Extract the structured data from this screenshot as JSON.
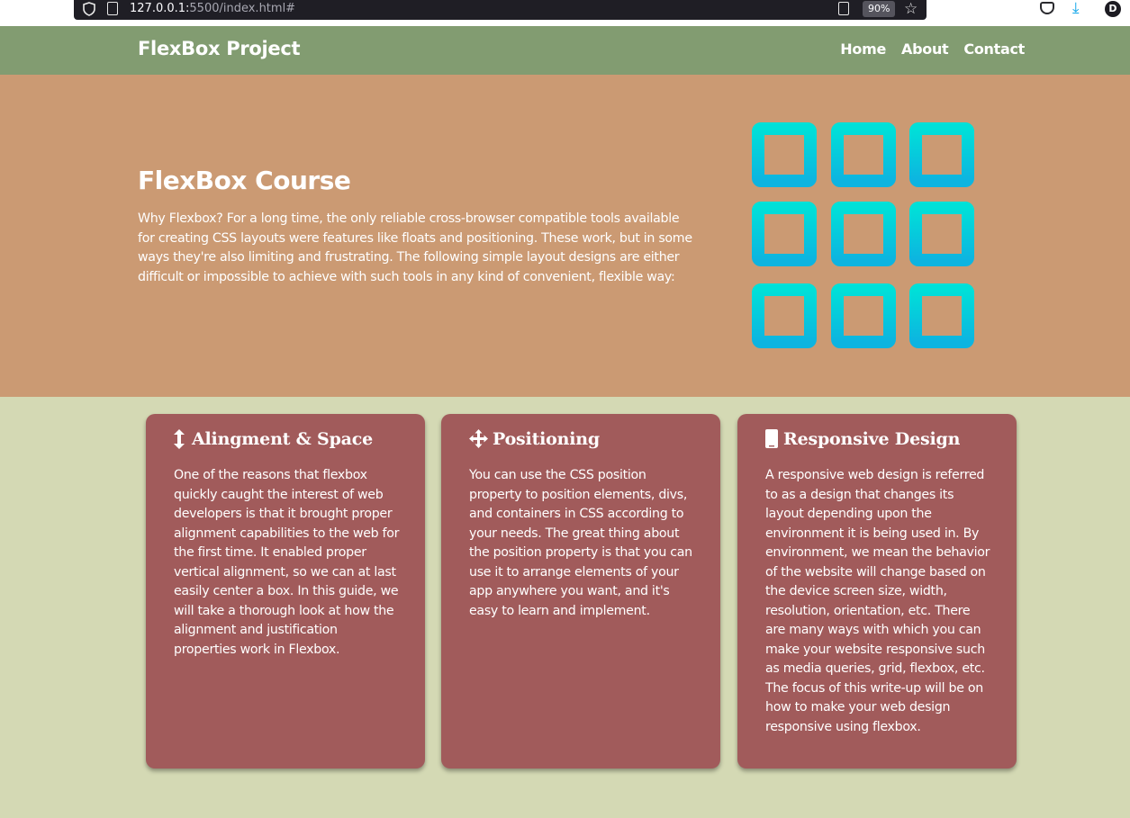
{
  "browser": {
    "url_host": "127.0.0.1:",
    "url_rest": "5500/index.html#",
    "zoom": "90%",
    "avatar_letter": "D",
    "icons": [
      "shield-icon",
      "page-icon",
      "reader-view-icon",
      "bookmark-star-icon",
      "pocket-icon",
      "download-icon",
      "account-avatar"
    ]
  },
  "nav": {
    "brand": "FlexBox Project",
    "links": [
      "Home",
      "About",
      "Contact"
    ]
  },
  "hero": {
    "title": "FlexBox Course",
    "text": "Why Flexbox? For a long time, the only reliable cross-browser compatible tools available for creating CSS layouts were features like floats and positioning. These work, but in some ways they're also limiting and frustrating. The following simple layout designs are either difficult or impossible to achieve with such tools in any kind of convenient, flexible way:",
    "illustration": "grid-squares-icon"
  },
  "cards": [
    {
      "icon": "vertical-arrows-icon",
      "title": "Alingment & Space",
      "text": "One of the reasons that flexbox quickly caught the interest of web developers is that it brought proper alignment capabilities to the web for the first time. It enabled proper vertical alignment, so we can at last easily center a box. In this guide, we will take a thorough look at how the alignment and justification properties work in Flexbox."
    },
    {
      "icon": "move-arrows-icon",
      "title": "Positioning",
      "text": "You can use the CSS position property to position elements, divs, and containers in CSS according to your needs. The great thing about the position property is that you can use it to arrange elements of your app anywhere you want, and it's easy to learn and implement."
    },
    {
      "icon": "mobile-phone-icon",
      "title": "Responsive Design",
      "text": "A responsive web design is referred to as a design that changes its layout depending upon the environment it is being used in. By environment, we mean the behavior of the website will change based on the device screen size, width, resolution, orientation, etc. There are many ways with which you can make your website responsive such as media queries, grid, flexbox, etc. The focus of this write-up will be on how to make your web design responsive using flexbox."
    }
  ],
  "colors": {
    "nav_bg": "#829c71",
    "hero_bg": "#cb9a73",
    "page_bg": "#d4d9b4",
    "card_bg": "#a15b5b",
    "grid_top": "#00e0d8",
    "grid_bottom": "#0db4e0"
  }
}
